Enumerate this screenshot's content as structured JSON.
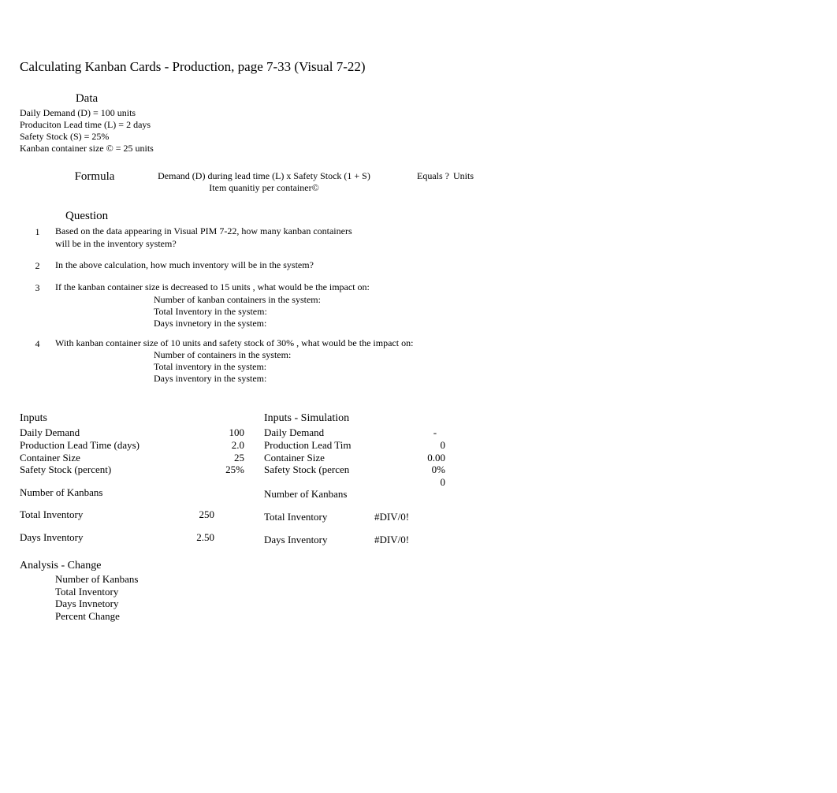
{
  "title": "Calculating Kanban Cards - Production, page 7-33  (Visual 7-22)",
  "data": {
    "header": "Data",
    "lines": [
      "Daily Demand (D) = 100 units",
      "Produciton Lead time (L) = 2 days",
      "Safety Stock (S) = 25%",
      "Kanban container size © = 25 units"
    ]
  },
  "formula": {
    "label": "Formula",
    "numerator": "Demand (D) during lead time (L) x Safety Stock (1 + S)",
    "denominator": "Item quanitiy per container©",
    "equals": "Equals ?",
    "units": "Units"
  },
  "question_header": "Question",
  "questions": [
    {
      "num": "1",
      "lines": [
        "Based on the data appearing in Visual PIM 7-22, how many kanban containers",
        "will be in the inventory system?"
      ],
      "subs": []
    },
    {
      "num": "2",
      "lines": [
        "In the above calculation, how much inventory will be in the system?"
      ],
      "subs": []
    },
    {
      "num": "3",
      "lines": [
        "If the kanban container size is decreased to 15 units  , what would be the impact on:"
      ],
      "subs": [
        "Number of kanban containers in the system:",
        "Total Inventory in the system:",
        "Days invnetory in the system:"
      ]
    },
    {
      "num": "4",
      "lines": [
        "With kanban container size of 10 units and safety stock of 30%  , what would be the impact on:"
      ],
      "subs": [
        "Number of containers in the system:",
        "Total inventory in the system:",
        "Days inventory in the system:"
      ]
    }
  ],
  "inputs": {
    "header": "Inputs",
    "rows": [
      {
        "label": "Daily Demand",
        "value": "100"
      },
      {
        "label": "Production Lead Time (days)",
        "value": "2.0"
      },
      {
        "label": "Container Size",
        "value": "25"
      },
      {
        "label": "Safety Stock (percent)",
        "value": "25%"
      }
    ],
    "kanbans_label": "Number of Kanbans",
    "total_inv_label": "Total Inventory",
    "total_inv_value": "250",
    "days_inv_label": "Days Inventory",
    "days_inv_value": "2.50"
  },
  "sim": {
    "header": "Inputs - Simulation",
    "rows": [
      {
        "label": "Daily Demand",
        "value": "-"
      },
      {
        "label": "Production Lead Tim",
        "value": "0"
      },
      {
        "label": "Container Size",
        "value": "0.00"
      },
      {
        "label": "Safety Stock (percen",
        "value": "0%"
      },
      {
        "label": "",
        "value": "0"
      }
    ],
    "kanbans_label": "Number of Kanbans",
    "total_inv_label": "Total Inventory",
    "total_inv_value": "#DIV/0!",
    "days_inv_label": "Days Inventory",
    "days_inv_value": "#DIV/0!"
  },
  "analysis": {
    "header": "Analysis - Change",
    "lines": [
      "Number of Kanbans",
      "Total Inventory",
      "Days Invnetory",
      "Percent Change"
    ]
  }
}
